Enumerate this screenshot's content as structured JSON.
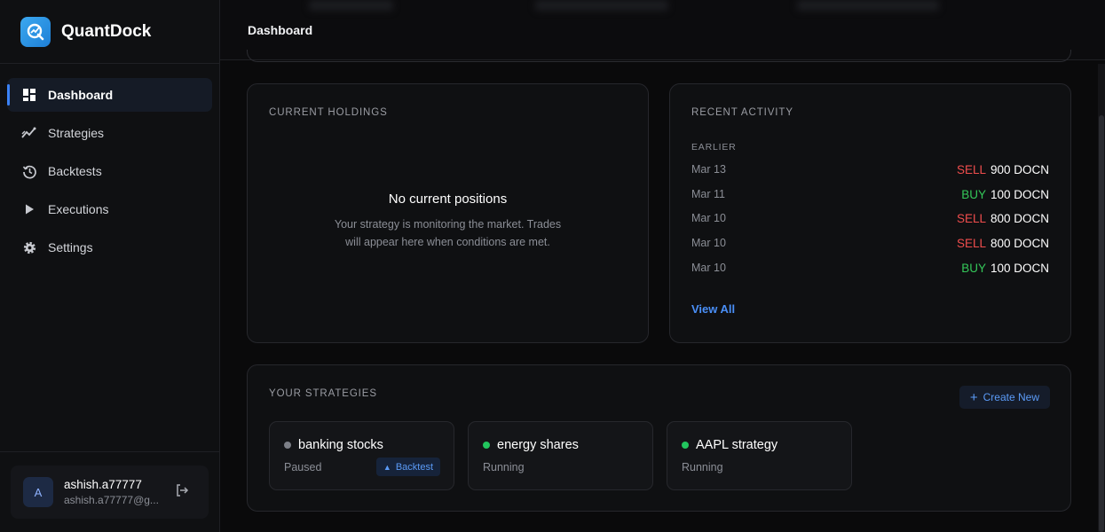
{
  "app": {
    "name": "QuantDock"
  },
  "sidebar": {
    "items": [
      {
        "label": "Dashboard",
        "icon": "dashboard-grid-icon",
        "active": true
      },
      {
        "label": "Strategies",
        "icon": "chart-line-icon",
        "active": false
      },
      {
        "label": "Backtests",
        "icon": "history-icon",
        "active": false
      },
      {
        "label": "Executions",
        "icon": "play-icon",
        "active": false
      },
      {
        "label": "Settings",
        "icon": "gear-icon",
        "active": false
      }
    ],
    "user": {
      "initial": "A",
      "name": "ashish.a77777",
      "email": "ashish.a77777@g..."
    }
  },
  "header": {
    "title": "Dashboard"
  },
  "holdings": {
    "title": "CURRENT HOLDINGS",
    "empty_title": "No current positions",
    "empty_desc": "Your strategy is monitoring the market. Trades will appear here when conditions are met."
  },
  "activity": {
    "title": "RECENT ACTIVITY",
    "group_label": "EARLIER",
    "rows": [
      {
        "date": "Mar 13",
        "side": "SELL",
        "qty_symbol": "900 DOCN"
      },
      {
        "date": "Mar 11",
        "side": "BUY",
        "qty_symbol": "100 DOCN"
      },
      {
        "date": "Mar 10",
        "side": "SELL",
        "qty_symbol": "800 DOCN"
      },
      {
        "date": "Mar 10",
        "side": "SELL",
        "qty_symbol": "800 DOCN"
      },
      {
        "date": "Mar 10",
        "side": "BUY",
        "qty_symbol": "100 DOCN"
      }
    ],
    "view_all": "View All"
  },
  "strategies": {
    "title": "YOUR STRATEGIES",
    "create_label": "Create New",
    "items": [
      {
        "name": "banking stocks",
        "status": "Paused",
        "badge": "Backtest"
      },
      {
        "name": "energy shares",
        "status": "Running",
        "badge": ""
      },
      {
        "name": "AAPL strategy",
        "status": "Running",
        "badge": ""
      }
    ]
  },
  "colors": {
    "accent": "#3b82f6",
    "sell": "#f04d4d",
    "buy": "#34c759",
    "running": "#22c55e",
    "paused": "#7c7f87"
  }
}
